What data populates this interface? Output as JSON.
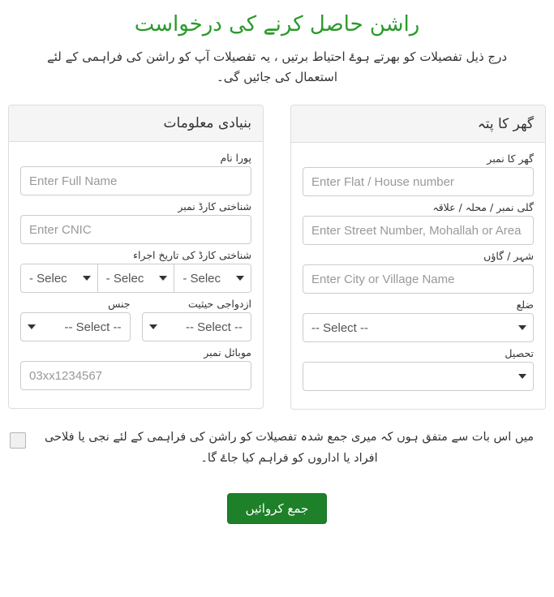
{
  "header": {
    "title": "راشن حاصل کرنے کی درخواست",
    "subtitle": "درج ذیل تفصیلات کو بھرتے ہوۓ احتیاط برتیں ، یہ تفصیلات آپ کو راشن کی فراہمی کے لئے استعمال کی جائیں گی۔",
    "title_color": "#2a9a2a"
  },
  "basic_info": {
    "panel_title": "بنیادی معلومات",
    "full_name": {
      "label": "پورا نام",
      "placeholder": "Enter Full Name",
      "value": ""
    },
    "cnic": {
      "label": "شناختی کارڈ نمبر",
      "placeholder": "Enter CNIC",
      "value": ""
    },
    "cnic_issue_date": {
      "label": "شناختی کارڈ کی تاریخ اجراء",
      "parts": [
        {
          "name": "day",
          "value": "- Selec"
        },
        {
          "name": "month",
          "value": "- Selec"
        },
        {
          "name": "year",
          "value": "- Selec"
        }
      ]
    },
    "gender": {
      "label": "جنس",
      "value": "-- Select --"
    },
    "marital_status": {
      "label": "ازدواجی حیثیت",
      "value": "-- Select --"
    },
    "mobile": {
      "label": "موبائل نمبر",
      "placeholder": "03xx1234567",
      "value": ""
    }
  },
  "home_address": {
    "panel_title": "گھر کا پتہ",
    "house_number": {
      "label": "گھر کا نمبر",
      "placeholder": "Enter Flat / House number",
      "value": ""
    },
    "street": {
      "label": "گلی نمبر / محلہ / علاقہ",
      "placeholder": "Enter Street Number, Mohallah or Area",
      "value": ""
    },
    "city": {
      "label": "شہر / گاؤں",
      "placeholder": "Enter City or Village Name",
      "value": ""
    },
    "district": {
      "label": "ضلع",
      "value": "-- Select --"
    },
    "tehsil": {
      "label": "تحصیل",
      "value": ""
    }
  },
  "consent": {
    "text": "میں اس بات سے متفق ہوں کہ میری جمع شدہ تفصیلات کو راشن کی فراہمی کے لئے نجی یا فلاحی افراد یا اداروں کو فراہم کیا جاۓ گا۔",
    "checked": false
  },
  "submit": {
    "label": "جمع کروائیں",
    "color": "#1e8028"
  }
}
